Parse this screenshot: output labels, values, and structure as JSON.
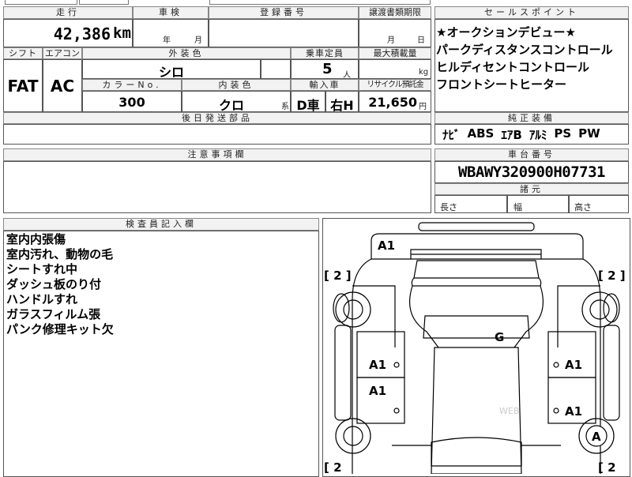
{
  "top_fragments": {
    "left": "",
    "mid": ""
  },
  "mileage": {
    "header": "走行",
    "value": "42,386",
    "unit": "km"
  },
  "inspection": {
    "header": "車検",
    "year_label": "年",
    "month_label": "月"
  },
  "registration": {
    "header": "登録番号"
  },
  "transfer_deadline": {
    "header": "譲渡書類期限",
    "month_label": "月",
    "day_label": "日"
  },
  "shift": {
    "header": "シフト",
    "value": "FAT"
  },
  "aircon": {
    "header": "エアコン",
    "value": "AC"
  },
  "exterior_color": {
    "header": "外装色",
    "value": "シロ"
  },
  "capacity": {
    "header": "乗車定員",
    "value": "5",
    "unit": "人"
  },
  "max_load": {
    "header": "最大積載量",
    "unit": "kg"
  },
  "color_no": {
    "header": "カラーNo.",
    "value": "300"
  },
  "interior_color": {
    "header": "内装色",
    "value": "クロ",
    "unit": "系"
  },
  "import_car": {
    "header": "輸入車",
    "type": "D車",
    "handle": "右H"
  },
  "recycle_fee": {
    "header": "リサイクル預託金",
    "value": "21,650",
    "unit": "円"
  },
  "parts_shipped": {
    "header": "後日発送部品"
  },
  "sales_points": {
    "header": "セールスポイント",
    "lines": [
      "★オークションデビュー★",
      "パークディスタンスコントロール",
      "ヒルディセントコントロール",
      "フロントシートヒーター"
    ]
  },
  "equipment": {
    "header": "純正装備",
    "items": [
      "ﾅﾋﾞ",
      "ABS",
      "ｴｱB",
      "ｱﾙﾐ",
      "PS",
      "PW"
    ]
  },
  "notes": {
    "header": "注意事項欄"
  },
  "chassis": {
    "header": "車台番号",
    "value": "WBAWY320900H07731"
  },
  "dimensions": {
    "header": "諸元",
    "length": "長さ",
    "width": "幅",
    "height": "高さ"
  },
  "inspector": {
    "header": "検査員記入欄",
    "lines": [
      "室内内張傷",
      "室内汚れ、動物の毛",
      "シートすれ中",
      "ダッシュ板のり付",
      "ハンドルすれ",
      "ガラスフィルム張",
      "パンク修理キット欠"
    ]
  },
  "diagram": {
    "marks": {
      "hood": "A1",
      "roof": "G",
      "left_front_door": "A1",
      "left_rear_door": "A1",
      "right_front_door": "A1",
      "right_rear_door": "A1",
      "rear_right_wheel": "A"
    },
    "tire_labels": {
      "front_left": "[ 2 ]",
      "front_right": "[ 2 ]",
      "rear_left": "[ 2",
      "rear_right": "[ 2"
    },
    "watermark": "WEB"
  }
}
